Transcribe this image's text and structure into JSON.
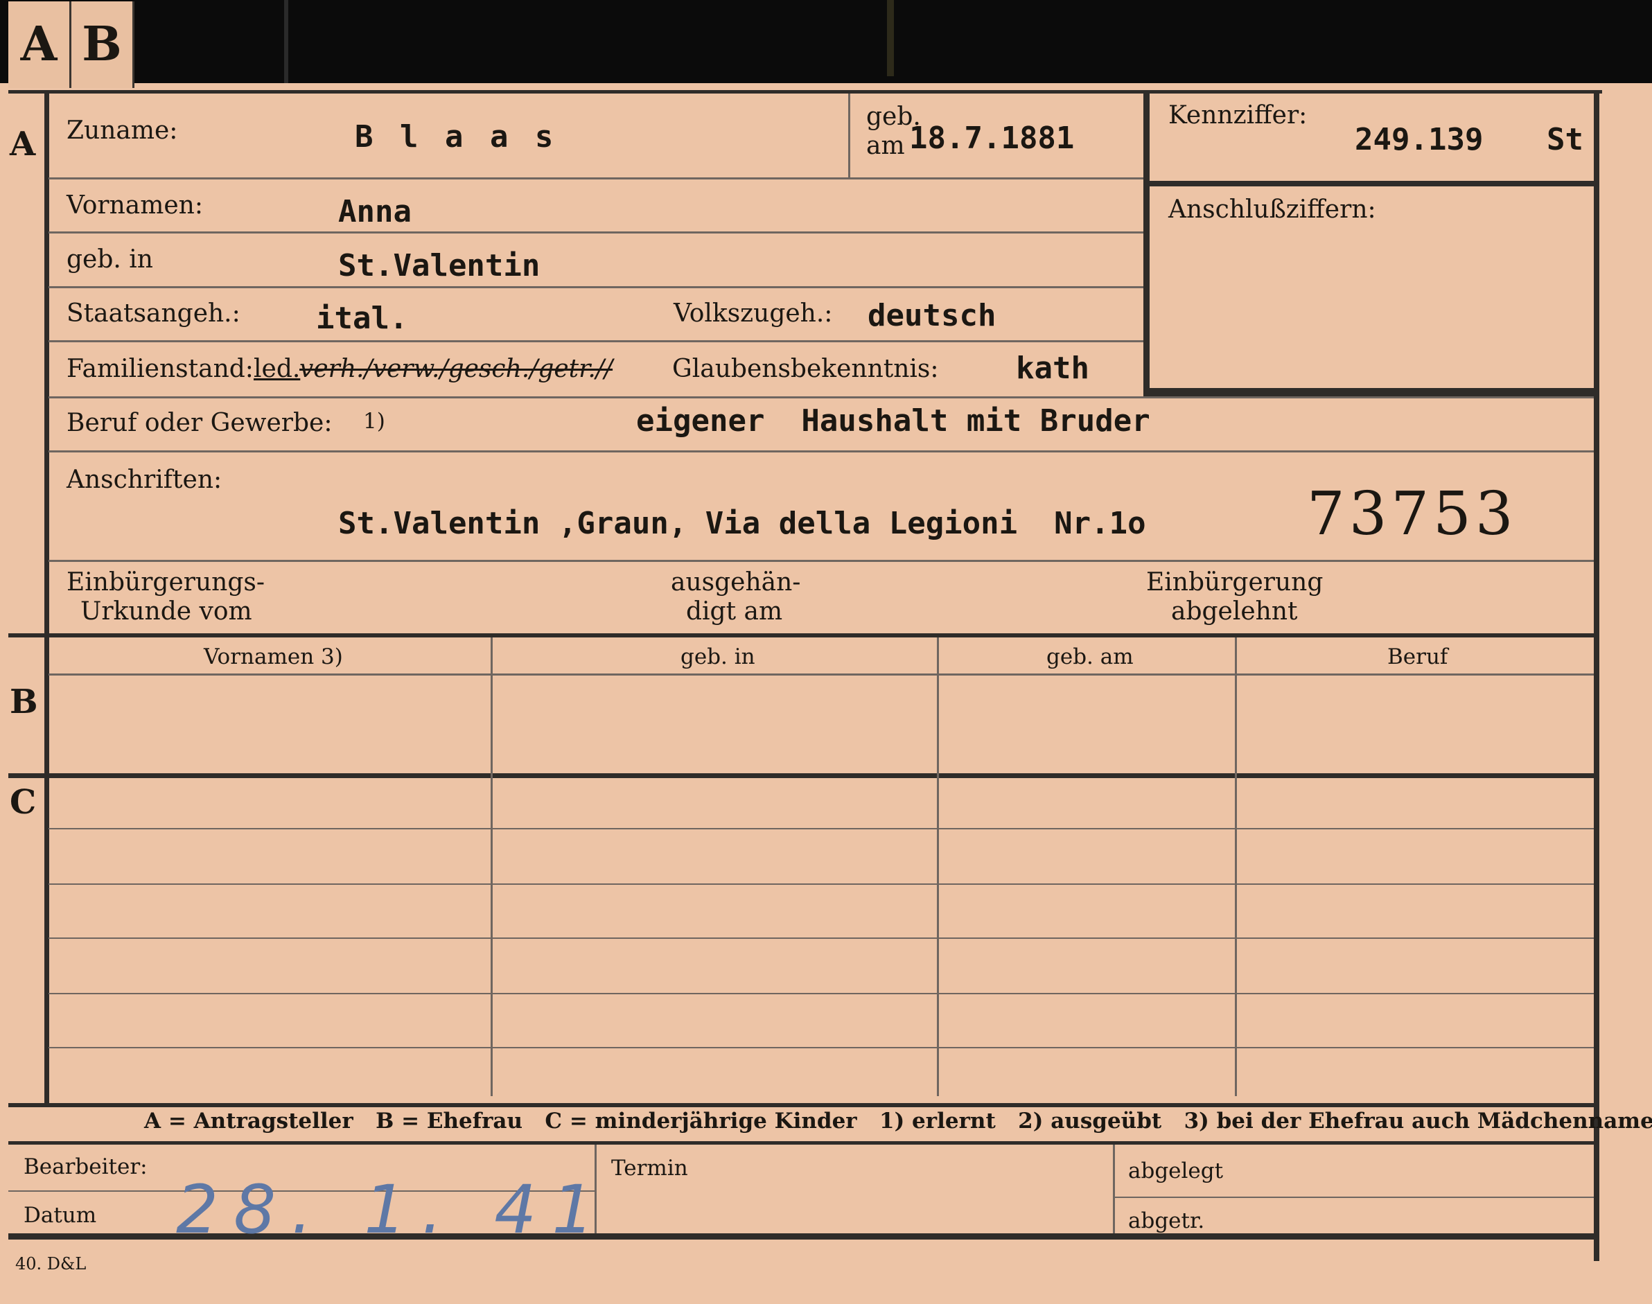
{
  "tabs": [
    "A",
    "B"
  ],
  "sections": {
    "a": "A",
    "b": "B",
    "c": "C"
  },
  "applicant": {
    "surname_label": "Zuname:",
    "surname": "B l a a s",
    "born_on_label_top": "geb.",
    "born_on_label_bottom": "am",
    "born_on": "18.7.1881",
    "id_label": "Kennziffer:",
    "id_value": "249.139",
    "id_suffix": "St",
    "connections_label": "Anschlußziffern:",
    "firstnames_label": "Vornamen:",
    "firstnames": "Anna",
    "birthplace_label": "geb. in",
    "birthplace": "St.Valentin",
    "citizenship_label": "Staatsangeh.:",
    "citizenship": "ital.",
    "ethnicity_label": "Volkszugeh.:",
    "ethnicity": "deutsch",
    "marital_label": "Familienstand:",
    "marital_status": "led.",
    "marital_crossed": "verh./verw./gesch./getr.//",
    "religion_label": "Glaubensbekenntnis:",
    "religion": "kath",
    "occupation_label": "Beruf oder Gewerbe:",
    "occupation_note": "1)",
    "occupation": "eigener  Haushalt mit Bruder",
    "address_label": "Anschriften:",
    "address": "St.Valentin ,Graun, Via della Legioni  Nr.1o",
    "stamp_number": "73753",
    "naturalization_doc_label_1": "Einbürgerungs-",
    "naturalization_doc_label_2": "Urkunde vom",
    "handed_label_1": "ausgehän-",
    "handed_label_2": "digt am",
    "refused_label_1": "Einbürgerung",
    "refused_label_2": "abgelehnt"
  },
  "table": {
    "headers": [
      "Vornamen 3)",
      "geb. in",
      "geb. am",
      "Beruf"
    ]
  },
  "legend": "A = Antragsteller   B = Ehefrau   C = minderjährige Kinder   1) erlernt   2) ausgeübt   3) bei der Ehefrau auch Mädchenname",
  "footer": {
    "clerk_label": "Bearbeiter:",
    "date_label": "Datum",
    "date_value": "28. 1. 41",
    "deadline_label": "Termin",
    "filed_label": "abgelegt",
    "sent_label": "abgetr.",
    "printer_mark": "40. D&L"
  }
}
